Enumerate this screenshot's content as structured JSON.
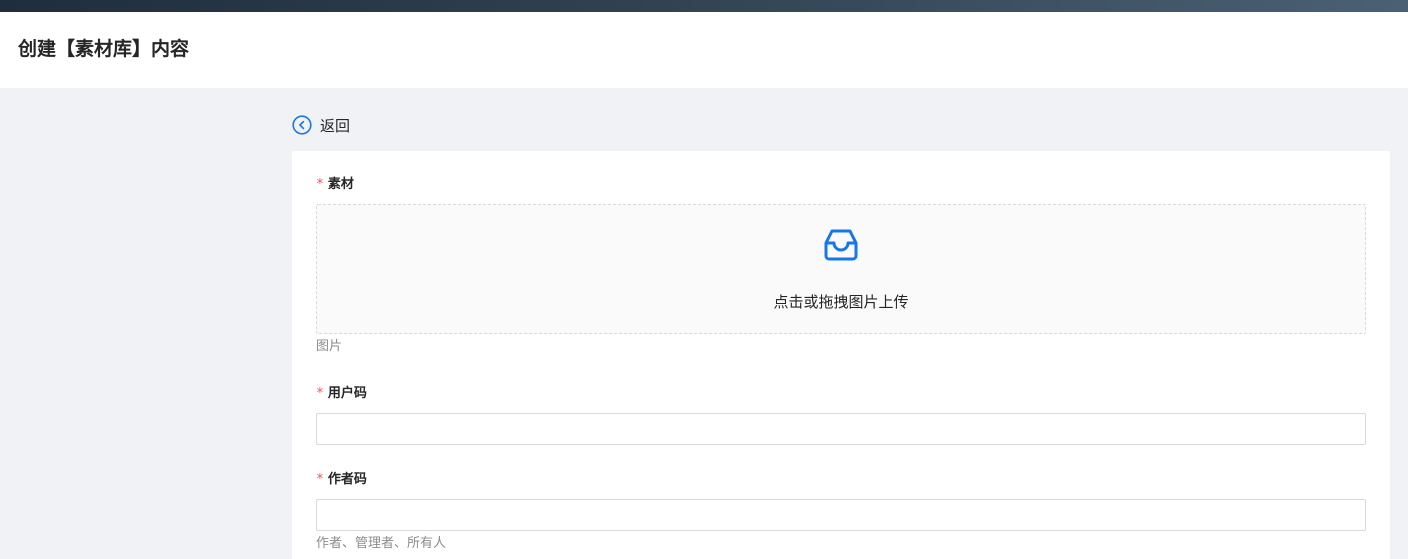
{
  "header": {
    "title": "创建【素材库】内容"
  },
  "back": {
    "label": "返回"
  },
  "form": {
    "material": {
      "required": "*",
      "label": "素材",
      "upload_text": "点击或拖拽图片上传",
      "help": "图片"
    },
    "user_code": {
      "required": "*",
      "label": "用户码",
      "value": ""
    },
    "author_code": {
      "required": "*",
      "label": "作者码",
      "value": "",
      "help": "作者、管理者、所有人"
    }
  },
  "colors": {
    "accent": "#1677e6",
    "required": "#ff4d4f",
    "page_bg": "#f0f2f5"
  },
  "icons": {
    "back": "circle-chevron-left-icon",
    "upload": "inbox-icon"
  }
}
